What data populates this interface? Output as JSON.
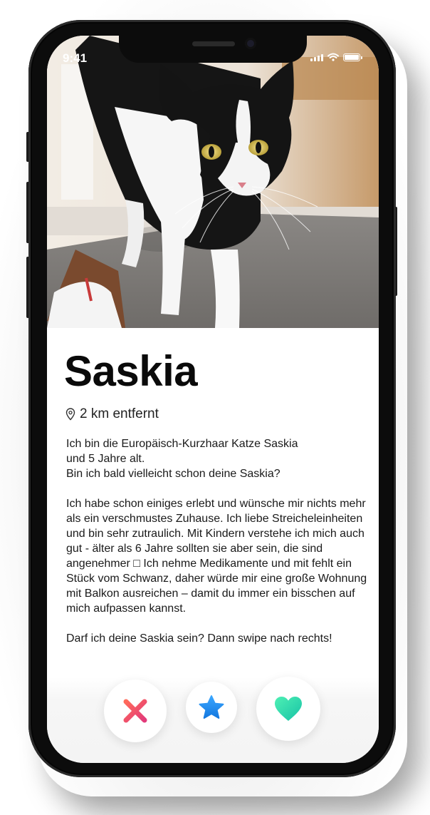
{
  "status_bar": {
    "time": "9:41",
    "icons": [
      "signal-icon",
      "wifi-icon",
      "battery-icon"
    ]
  },
  "profile": {
    "name": "Saskia",
    "distance": "2 km entfernt",
    "location_icon": "location-pin-icon",
    "photo_alt": "Katze Saskia",
    "bio": [
      "Ich bin die Europäisch-Kurzhaar Katze Saskia\nund 5 Jahre alt.\nBin ich bald vielleicht schon deine Saskia?",
      "Ich habe schon einiges erlebt und wünsche mir nichts mehr als ein verschmustes Zuhause. Ich liebe Streicheleinheiten und bin sehr zutraulich. Mit Kindern verstehe ich mich auch gut - älter als 6 Jahre sollten sie aber sein, die sind angenehmer □ Ich nehme Medikamente und mit fehlt ein Stück vom Schwanz, daher würde mir eine große Wohnung mit Balkon ausreichen – damit du immer ein bisschen auf mich aufpassen kannst.",
      "Darf ich deine Saskia sein? Dann swipe nach rechts!"
    ]
  },
  "actions": [
    {
      "name": "nope",
      "icon": "close-icon",
      "color": "#f0506e"
    },
    {
      "name": "super-like",
      "icon": "star-icon",
      "color": "#1e90f5"
    },
    {
      "name": "like",
      "icon": "heart-icon",
      "color": "#2fd4a0"
    }
  ],
  "colors": {
    "nope_gradient": [
      "#ff5a5f",
      "#e0407a"
    ],
    "star": "#1e8ff0",
    "heart_gradient": [
      "#45e8b0",
      "#1fc5a8"
    ]
  }
}
